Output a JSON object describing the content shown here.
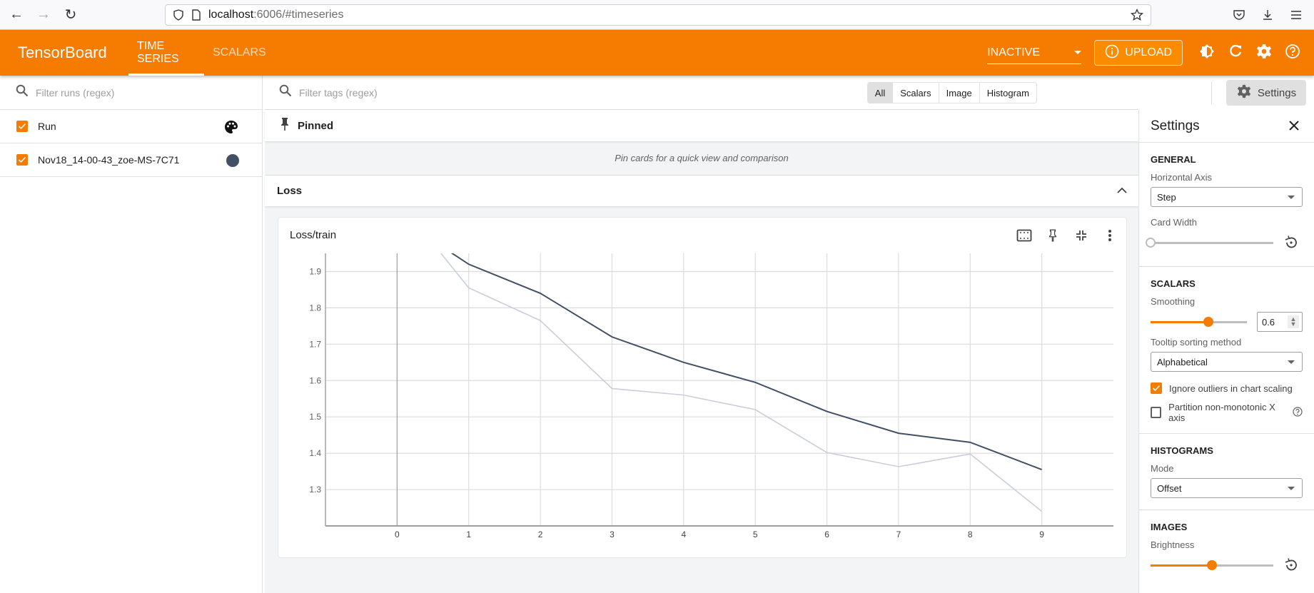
{
  "browser": {
    "url_host": "localhost",
    "url_path": ":6006/#timeseries",
    "back_icon": "arrow-left-icon",
    "forward_icon": "arrow-right-icon",
    "reload_icon": "reload-icon"
  },
  "header": {
    "brand": "TensorBoard",
    "tabs": [
      {
        "label": "TIME SERIES",
        "active": true
      },
      {
        "label": "SCALARS",
        "active": false
      }
    ],
    "status_select": "INACTIVE",
    "upload_label": "UPLOAD",
    "accent": "#f57c00"
  },
  "runs": {
    "filter_placeholder": "Filter runs (regex)",
    "items": [
      {
        "label": "Run",
        "checked": true,
        "icon": "palette-icon"
      },
      {
        "label": "Nov18_14-00-43_zoe-MS-7C71",
        "checked": true,
        "color": "#425066"
      }
    ]
  },
  "main": {
    "tag_filter_placeholder": "Filter tags (regex)",
    "type_filters": [
      "All",
      "Scalars",
      "Image",
      "Histogram"
    ],
    "selected_type": "All",
    "settings_button": "Settings",
    "pinned_title": "Pinned",
    "pinned_empty": "Pin cards for a quick view and comparison",
    "group_title": "Loss",
    "card_title": "Loss/train"
  },
  "settings": {
    "title": "Settings",
    "general": {
      "heading": "GENERAL",
      "horizontal_axis_label": "Horizontal Axis",
      "horizontal_axis_value": "Step",
      "card_width_label": "Card Width",
      "card_width_value": 0
    },
    "scalars": {
      "heading": "SCALARS",
      "smoothing_label": "Smoothing",
      "smoothing_value": "0.6",
      "smoothing_fraction": 0.6,
      "tooltip_label": "Tooltip sorting method",
      "tooltip_value": "Alphabetical",
      "ignore_outliers_label": "Ignore outliers in chart scaling",
      "ignore_outliers_checked": true,
      "partition_label": "Partition non-monotonic X axis",
      "partition_checked": false
    },
    "histograms": {
      "heading": "HISTOGRAMS",
      "mode_label": "Mode",
      "mode_value": "Offset"
    },
    "images": {
      "heading": "IMAGES",
      "brightness_label": "Brightness",
      "brightness_fraction": 0.5
    }
  },
  "chart_data": {
    "type": "line",
    "title": "Loss/train",
    "xlabel": "Step",
    "ylabel": "",
    "x": [
      0,
      1,
      2,
      3,
      4,
      5,
      6,
      7,
      8,
      9
    ],
    "xlim": [
      -1,
      10
    ],
    "ylim": [
      1.2,
      1.95
    ],
    "x_ticks": [
      "0",
      "1",
      "2",
      "3",
      "4",
      "5",
      "6",
      "7",
      "8",
      "9"
    ],
    "y_ticks": [
      "1.3",
      "1.4",
      "1.5",
      "1.6",
      "1.7",
      "1.8",
      "1.9"
    ],
    "grid": true,
    "series": [
      {
        "name": "Nov18_14-00-43_zoe-MS-7C71 (smoothed)",
        "color": "#425066",
        "values": [
          2.05,
          1.92,
          1.84,
          1.72,
          1.65,
          1.595,
          1.515,
          1.455,
          1.43,
          1.355
        ]
      },
      {
        "name": "Nov18_14-00-43_zoe-MS-7C71 (raw)",
        "color": "#c9cedb",
        "values": [
          2.1,
          1.855,
          1.765,
          1.578,
          1.56,
          1.52,
          1.402,
          1.363,
          1.398,
          1.24
        ]
      }
    ]
  }
}
